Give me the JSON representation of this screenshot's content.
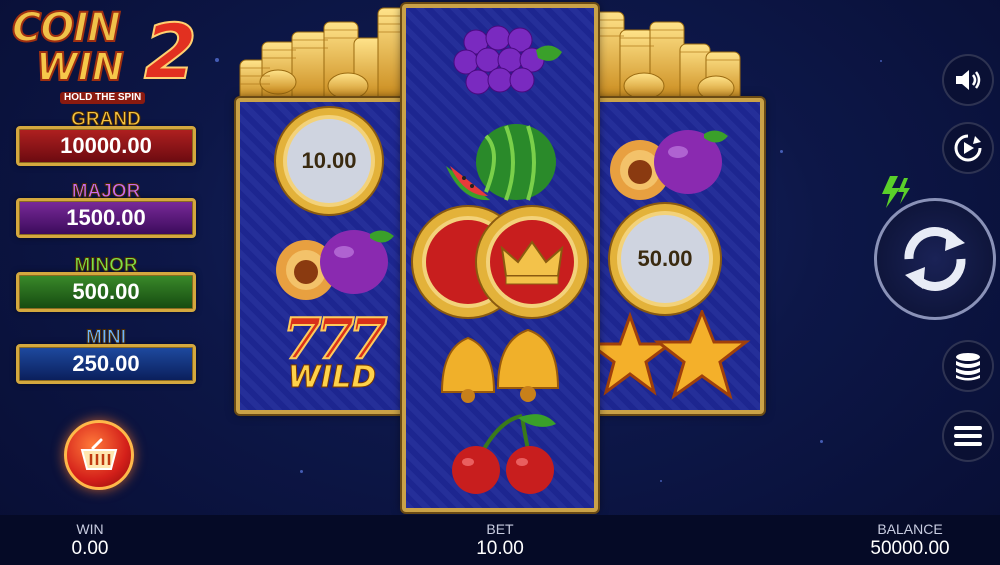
{
  "logo": {
    "line1": "COIN",
    "line2": "WIN",
    "number": "2",
    "tagline": "HOLD THE SPIN"
  },
  "jackpots": {
    "grand": {
      "label": "GRAND",
      "value": "10000.00"
    },
    "major": {
      "label": "MAJOR",
      "value": "1500.00"
    },
    "minor": {
      "label": "MINOR",
      "value": "500.00"
    },
    "mini": {
      "label": "MINI",
      "value": "250.00"
    }
  },
  "reels": {
    "left": [
      {
        "type": "coin",
        "value": "10.00"
      },
      {
        "type": "plum",
        "value": ""
      },
      {
        "type": "wild",
        "value": "777",
        "caption": "WILD"
      }
    ],
    "middle": [
      {
        "type": "grapes",
        "value": ""
      },
      {
        "type": "watermelon",
        "value": ""
      },
      {
        "type": "crown-coin",
        "value": ""
      },
      {
        "type": "bells",
        "value": ""
      },
      {
        "type": "cherries",
        "value": ""
      }
    ],
    "right": [
      {
        "type": "plum",
        "value": ""
      },
      {
        "type": "coin",
        "value": "50.00"
      },
      {
        "type": "stars",
        "value": ""
      }
    ]
  },
  "controls": [
    "sound-icon",
    "autoplay-icon",
    "turbo-icon",
    "spin-icon",
    "bet-stack-icon",
    "menu-icon"
  ],
  "bottom_bar": {
    "win": {
      "label": "WIN",
      "value": "0.00"
    },
    "bet": {
      "label": "BET",
      "value": "10.00"
    },
    "balance": {
      "label": "BALANCE",
      "value": "50000.00"
    }
  },
  "colors": {
    "frame_gold": "#caa248",
    "reel_bg": "#1e2896",
    "background": "#0d1748"
  }
}
